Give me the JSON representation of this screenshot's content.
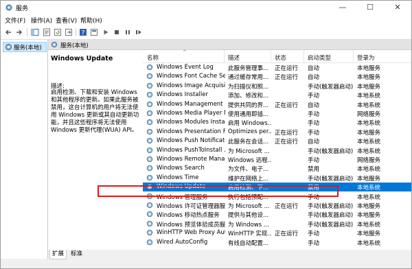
{
  "window": {
    "title": "服务",
    "controls": {
      "minimize": "—",
      "maximize": "☐",
      "close": "✕"
    }
  },
  "menu": [
    "文件(F)",
    "操作(A)",
    "查看(V)",
    "帮助(H)"
  ],
  "tree": {
    "label": "服务(本地)"
  },
  "pane_header": "服务(本地)",
  "detail": {
    "title": "Windows Update",
    "desc_label": "描述:",
    "description": "启用检测、下载和安装 Windows 和其他程序的更新。如果此服务被禁用，这台计算机的用户将无法使用 Windows 更新或其自动更新功能，并且这些程序将无法使用 Windows 更新代理(WUA) API。"
  },
  "columns": [
    "名称",
    "描述",
    "状态",
    "启动类型",
    "登录为"
  ],
  "rows": [
    {
      "name": "Windows Event Log",
      "desc": "此服务管理事...",
      "status": "正在运行",
      "startup": "自动",
      "logon": "本地服务"
    },
    {
      "name": "Windows Font Cache Ser...",
      "desc": "通过缓存常用...",
      "status": "正在运行",
      "startup": "自动",
      "logon": "本地服务"
    },
    {
      "name": "Windows Image Acquisiti...",
      "desc": "为扫描仪和照...",
      "status": "",
      "startup": "手动(触发器启动)",
      "logon": "本地服务"
    },
    {
      "name": "Windows Installer",
      "desc": "添加、修改和...",
      "status": "",
      "startup": "手动",
      "logon": "本地系统"
    },
    {
      "name": "Windows Management I...",
      "desc": "提供共同的界...",
      "status": "正在运行",
      "startup": "自动",
      "logon": "本地系统"
    },
    {
      "name": "Windows Media Player N...",
      "desc": "使用通用即插...",
      "status": "",
      "startup": "手动",
      "logon": "网络服务"
    },
    {
      "name": "Windows Modules Install...",
      "desc": "启用 Windows...",
      "status": "",
      "startup": "手动",
      "logon": "本地系统"
    },
    {
      "name": "Windows Presentation Fo...",
      "desc": "Optimizes per...",
      "status": "正在运行",
      "startup": "手动",
      "logon": "本地服务"
    },
    {
      "name": "Windows Push Notificati...",
      "desc": "此服务在会话...",
      "status": "正在运行",
      "startup": "自动",
      "logon": "本地系统"
    },
    {
      "name": "Windows PushToInstall ...",
      "desc": "为 Microsoft ...",
      "status": "",
      "startup": "手动(触发器启动)",
      "logon": "本地系统"
    },
    {
      "name": "Windows Remote Manag...",
      "desc": "Windows 远程...",
      "status": "",
      "startup": "手动",
      "logon": "网络服务"
    },
    {
      "name": "Windows Search",
      "desc": "为文件、电子...",
      "status": "",
      "startup": "禁用",
      "logon": "本地系统"
    },
    {
      "name": "Windows Time",
      "desc": "维护在网络上...",
      "status": "",
      "startup": "手动(触发器启动)",
      "logon": "本地服务"
    },
    {
      "name": "Windows Update",
      "desc": "启用检测、下...",
      "status": "",
      "startup": "禁用",
      "logon": "本地系统"
    },
    {
      "name": "Windows 管理服务",
      "desc": "执行包括预配...",
      "status": "",
      "startup": "手动",
      "logon": "本地系统"
    },
    {
      "name": "Windows 许可证管理器服务",
      "desc": "为 Microsoft ...",
      "status": "正在运行",
      "startup": "手动(触发器启动)",
      "logon": "本地服务"
    },
    {
      "name": "Windows 移动热点服务",
      "desc": "提供与其他设...",
      "status": "",
      "startup": "手动(触发器启动)",
      "logon": "本地服务"
    },
    {
      "name": "Windows 预览体验成员服务",
      "desc": "为 Windows ...",
      "status": "",
      "startup": "手动(触发器启动)",
      "logon": "本地系统"
    },
    {
      "name": "WinHTTP Web Proxy Aut...",
      "desc": "WinHTTP 实现...",
      "status": "正在运行",
      "startup": "手动",
      "logon": "本地服务"
    },
    {
      "name": "Wired AutoConfig",
      "desc": "有线自动配置...",
      "status": "",
      "startup": "手动",
      "logon": "本地系统"
    }
  ],
  "tabs": [
    "扩展",
    "标准"
  ],
  "colors": {
    "selection": "#0078d7",
    "highlight_box": "#e01818",
    "tree_selected": "#cde8ff"
  }
}
